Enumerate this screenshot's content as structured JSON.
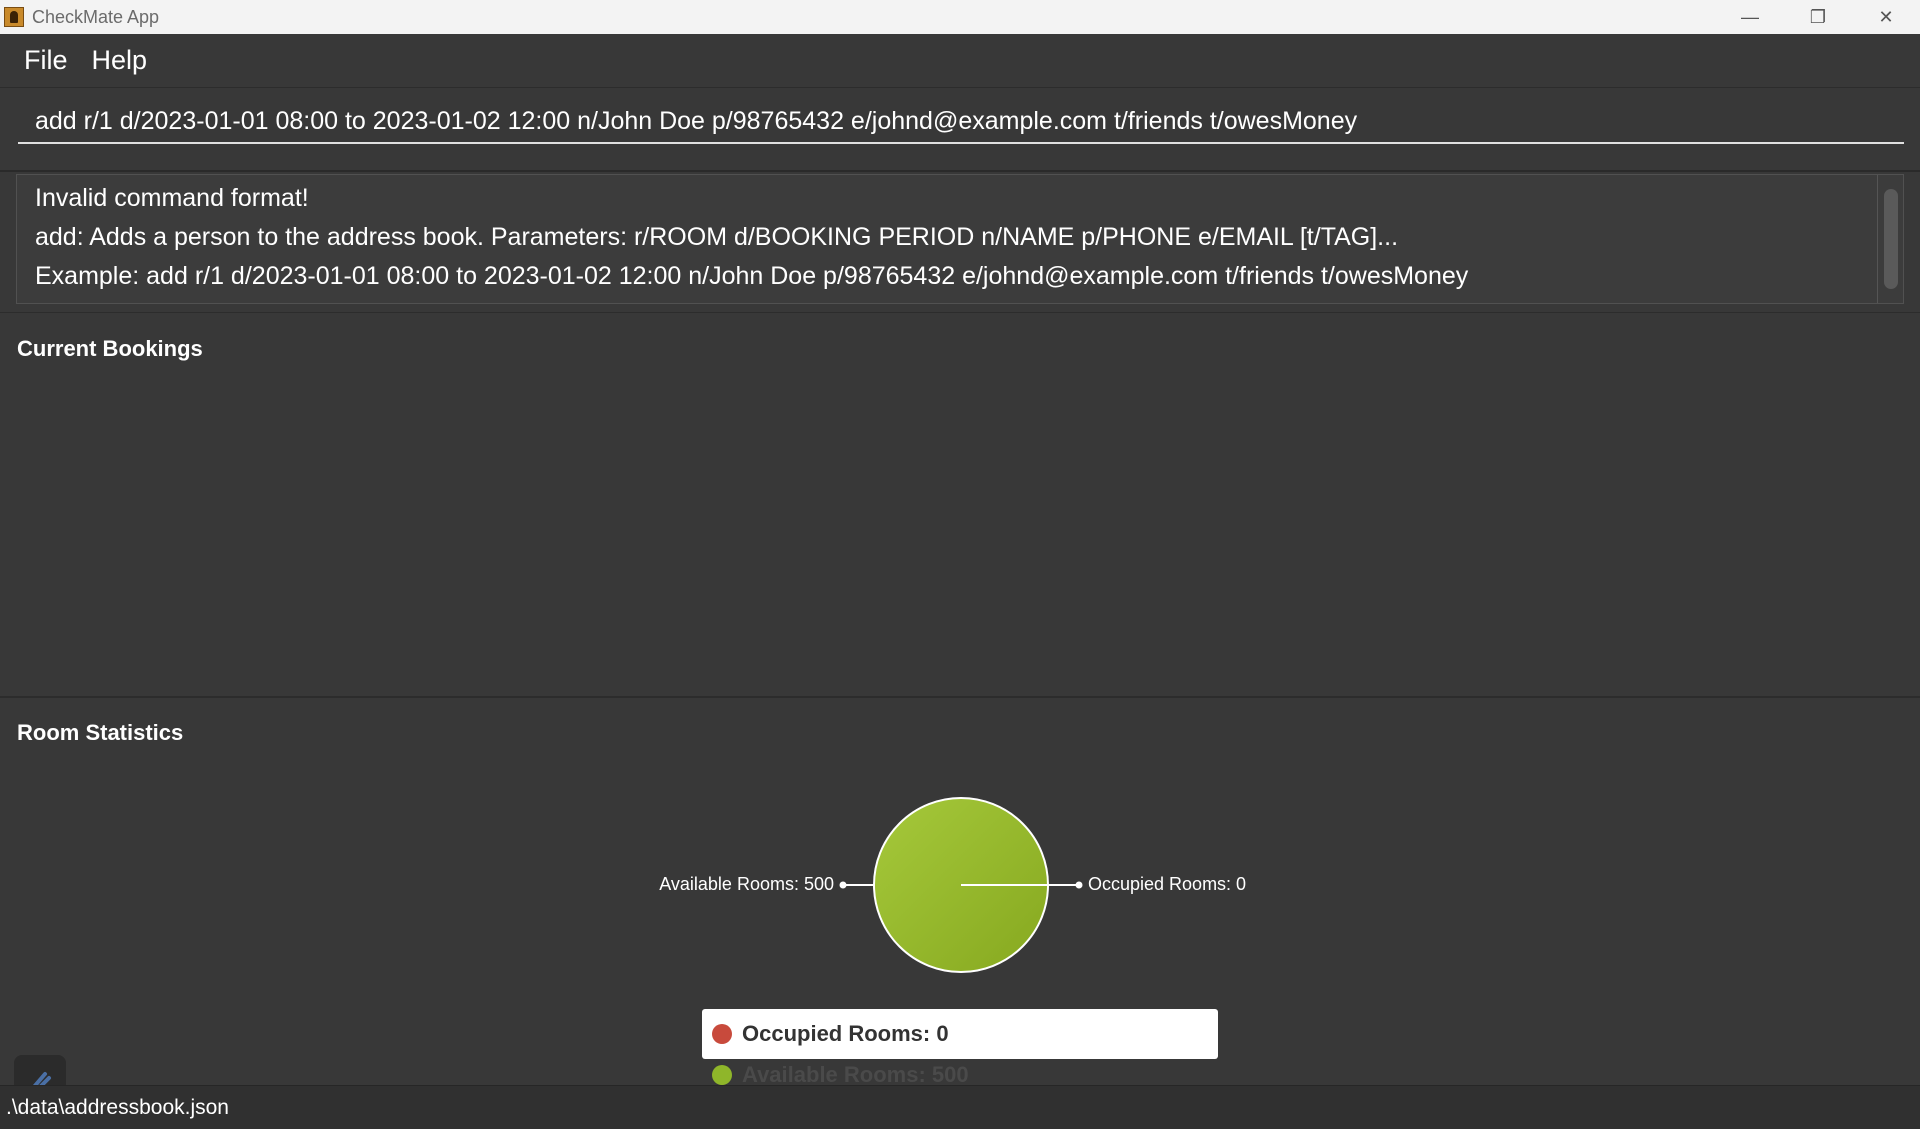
{
  "window": {
    "title": "CheckMate App",
    "minimize_glyph": "—",
    "restore_glyph": "❐",
    "close_glyph": "✕"
  },
  "menu": {
    "items": [
      {
        "label": "File"
      },
      {
        "label": "Help"
      }
    ]
  },
  "command_box": {
    "value": "add r/1 d/2023-01-01 08:00 to 2023-01-02 12:00 n/John Doe p/98765432 e/johnd@example.com t/friends t/owesMoney"
  },
  "result_display": {
    "lines": [
      "Invalid command format!",
      "add: Adds a person to the address book. Parameters: r/ROOM d/BOOKING PERIOD n/NAME p/PHONE e/EMAIL [t/TAG]...",
      "Example: add r/1 d/2023-01-01 08:00 to 2023-01-02 12:00 n/John Doe p/98765432 e/johnd@example.com t/friends t/owesMoney"
    ]
  },
  "bookings_panel": {
    "title": "Current Bookings"
  },
  "stats_panel": {
    "title": "Room Statistics",
    "pie_labels": {
      "available": "Available Rooms: 500",
      "occupied": "Occupied Rooms: 0"
    },
    "legend": {
      "occupied": "Occupied Rooms: 0",
      "available": "Available Rooms: 500"
    }
  },
  "chart_data": {
    "type": "pie",
    "categories": [
      "Occupied Rooms",
      "Available Rooms"
    ],
    "values": [
      0,
      500
    ],
    "colors": [
      "#c84a3c",
      "#9ac232"
    ]
  },
  "status_bar": {
    "path": ".\\data\\addressbook.json"
  },
  "colors": {
    "background": "#383838",
    "occupied": "#c84a3c",
    "available": "#9ac232"
  }
}
